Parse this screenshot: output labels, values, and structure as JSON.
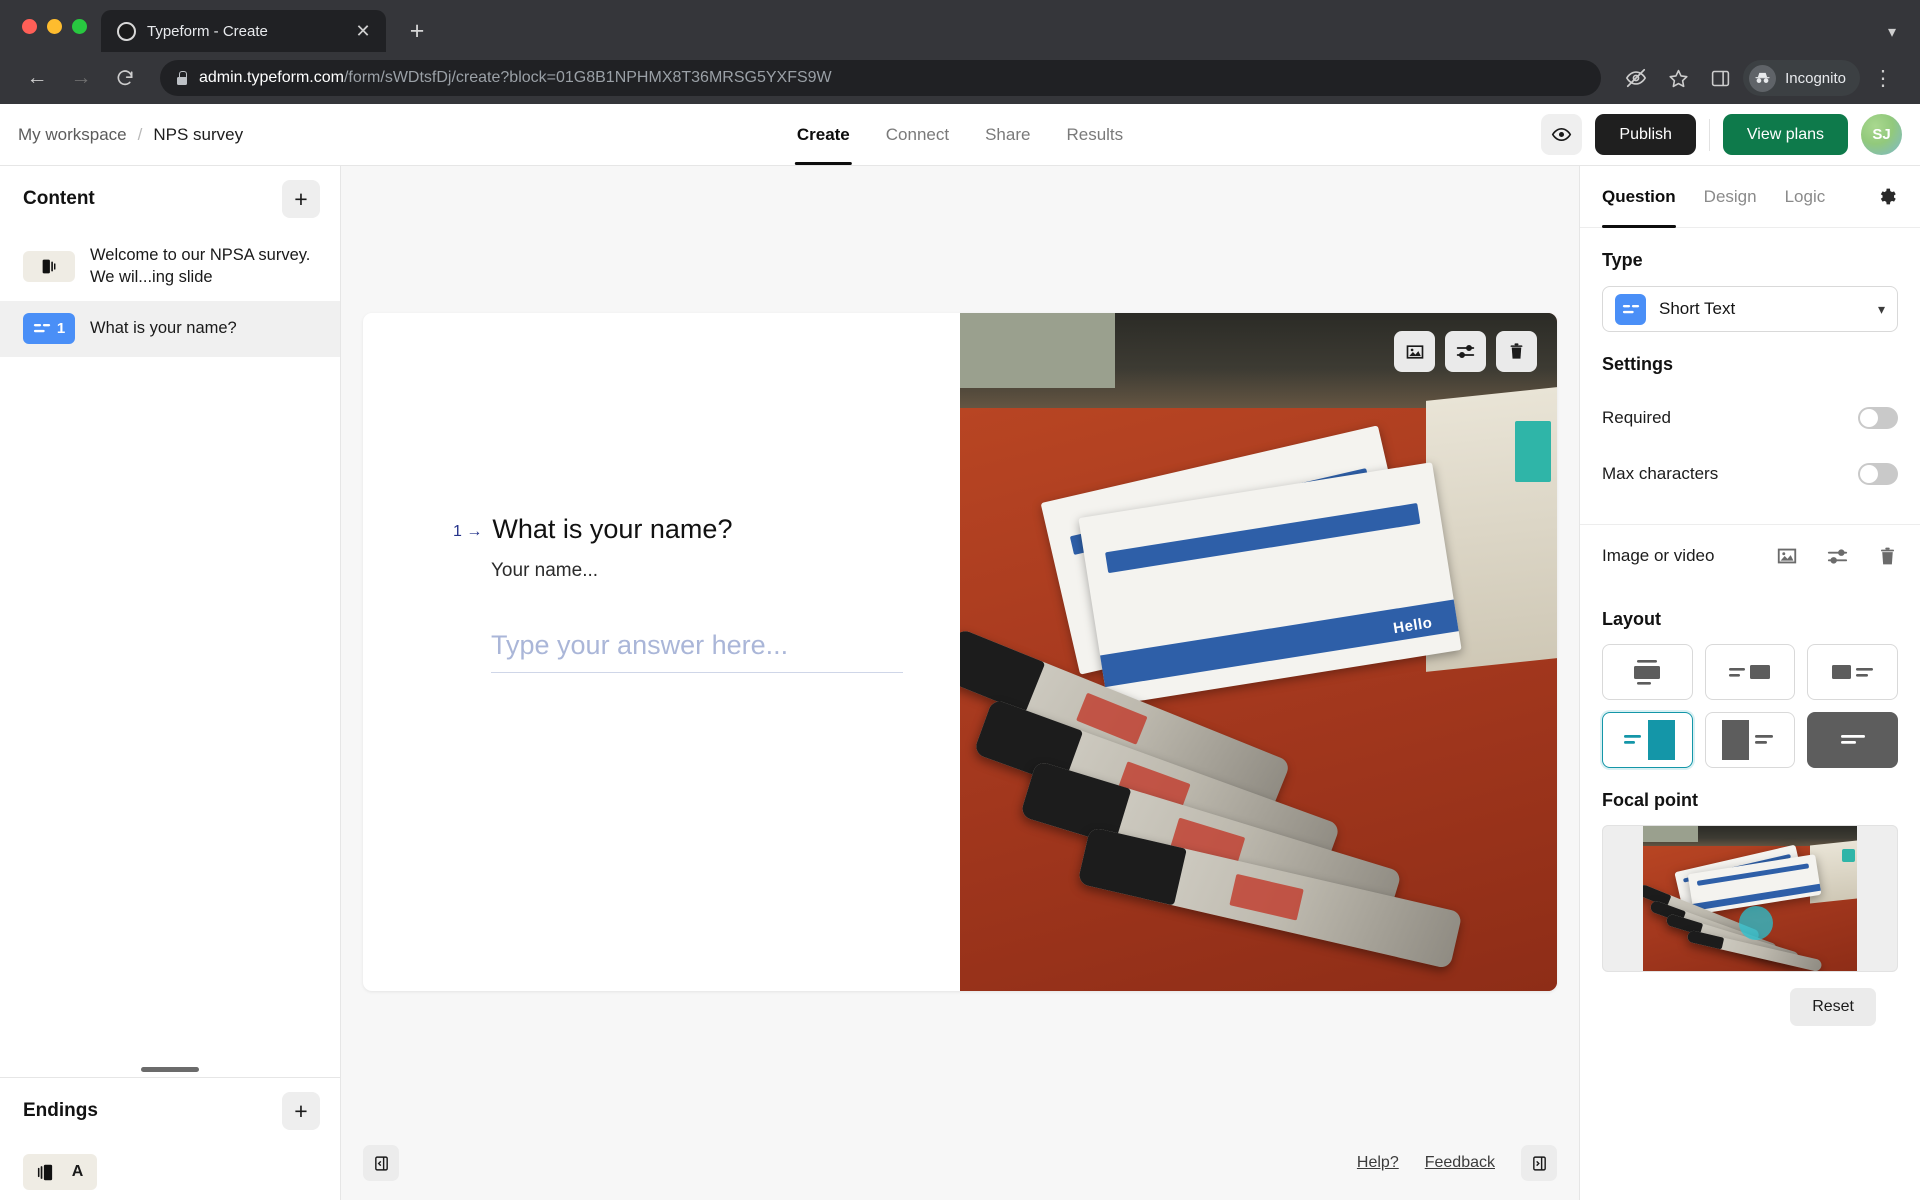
{
  "browser": {
    "tab": {
      "title": "Typeform - Create",
      "favicon_icon": "circle-favicon",
      "close_icon": "close-icon"
    },
    "new_tab_icon": "plus-icon",
    "tab_list_caret_icon": "chevron-down-icon",
    "back_icon": "back-arrow-icon",
    "forward_icon": "forward-arrow-icon",
    "reload_icon": "reload-icon",
    "lock_icon": "lock-icon",
    "url_host": "admin.typeform.com",
    "url_path": "/form/sWDtsfDj/create?block=01G8B1NPHMX8T36MRSG5YXFS9W",
    "eye_off_icon": "eye-off-icon",
    "star_icon": "star-icon",
    "sidepanel_icon": "side-panel-icon",
    "incognito_label": "Incognito",
    "incognito_icon": "incognito-icon",
    "menu_icon": "kebab-menu-icon"
  },
  "header": {
    "breadcrumb": {
      "workspace": "My workspace",
      "separator": "/",
      "form": "NPS survey"
    },
    "tabs": [
      {
        "label": "Create",
        "active": true
      },
      {
        "label": "Connect",
        "active": false
      },
      {
        "label": "Share",
        "active": false
      },
      {
        "label": "Results",
        "active": false
      }
    ],
    "preview_icon": "eye-icon",
    "publish_label": "Publish",
    "view_plans_label": "View plans",
    "avatar_initials": "SJ"
  },
  "sidebar": {
    "content_title": "Content",
    "add_icon": "plus-icon",
    "blocks": [
      {
        "label": "Welcome to our NPSA survey. We wil...ing slide",
        "badge_icon": "welcome-screen-icon",
        "badge_number": "",
        "selected": false
      },
      {
        "label": "What is your name?",
        "badge_icon": "short-text-icon",
        "badge_number": "1",
        "selected": true
      }
    ],
    "endings_title": "Endings",
    "endings_add_icon": "plus-icon",
    "endings": [
      {
        "badge_icon": "ending-screen-icon",
        "letter": "A"
      }
    ]
  },
  "canvas": {
    "question_number": "1",
    "arrow_icon": "arrow-right-icon",
    "question_title": "What is your name?",
    "question_description": "Your name...",
    "answer_placeholder": "Type your answer here...",
    "answer_value": "",
    "image_toolbar": [
      {
        "icon": "image-icon",
        "name": "change-image-button"
      },
      {
        "icon": "adjust-sliders-icon",
        "name": "adjust-image-button"
      },
      {
        "icon": "trash-icon",
        "name": "delete-image-button"
      }
    ],
    "collapse_left_icon": "collapse-left-panel-icon",
    "collapse_right_icon": "collapse-right-panel-icon",
    "help_label": "Help?",
    "feedback_label": "Feedback"
  },
  "right_panel": {
    "tabs": [
      {
        "label": "Question",
        "active": true
      },
      {
        "label": "Design",
        "active": false
      },
      {
        "label": "Logic",
        "active": false
      }
    ],
    "gear_icon": "gear-icon",
    "type_section_title": "Type",
    "type_value": "Short Text",
    "type_icon": "short-text-icon",
    "type_caret_icon": "chevron-down-icon",
    "settings_title": "Settings",
    "settings": [
      {
        "label": "Required",
        "enabled": false
      },
      {
        "label": "Max characters",
        "enabled": false
      }
    ],
    "image_or_video_label": "Image or video",
    "image_or_video_icons": [
      {
        "icon": "image-icon",
        "name": "replace-media-button"
      },
      {
        "icon": "adjust-sliders-icon",
        "name": "adjust-media-button"
      },
      {
        "icon": "trash-icon",
        "name": "remove-media-button"
      }
    ],
    "layout_title": "Layout",
    "layouts": [
      {
        "name": "layout-stacked-center",
        "active": false
      },
      {
        "name": "layout-text-left-image-right-small",
        "active": false
      },
      {
        "name": "layout-image-left-small-text-right",
        "active": false
      },
      {
        "name": "layout-text-left-image-right-full",
        "active": true
      },
      {
        "name": "layout-image-left-full-text-right",
        "active": false
      },
      {
        "name": "layout-image-background",
        "active": false
      }
    ],
    "focal_point_title": "Focal point",
    "reset_label": "Reset"
  },
  "colors": {
    "accent_blue": "#4a8ff7",
    "publish_black": "#1f1f1f",
    "plans_green": "#0e7a4b",
    "layout_active_teal": "#1496a8",
    "question_number_blue": "#26348b",
    "placeholder_blue": "#aab6d8"
  }
}
